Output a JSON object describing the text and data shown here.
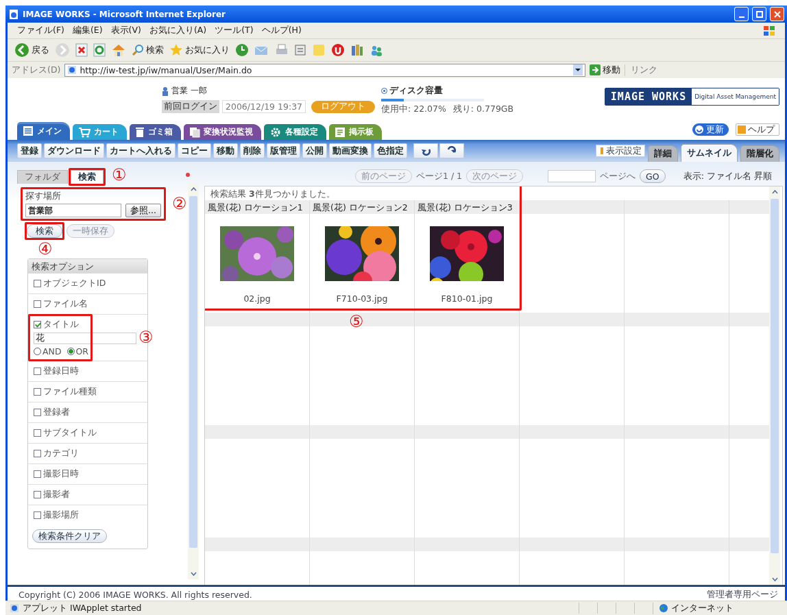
{
  "window": {
    "title": "IMAGE WORKS - Microsoft Internet Explorer"
  },
  "menu_bar": [
    "ファイル(F)",
    "編集(E)",
    "表示(V)",
    "お気に入り(A)",
    "ツール(T)",
    "ヘルプ(H)"
  ],
  "browser_toolbar": {
    "back": "戻る",
    "search": "検索",
    "favorites": "お気に入り"
  },
  "address_bar": {
    "label": "アドレス(D)",
    "url": "http://iw-test.jp/iw/manual/User/Main.do",
    "go": "移動",
    "links": "リンク"
  },
  "header": {
    "user": "営業 一郎",
    "last_login_label": "前回ログイン",
    "last_login": "2006/12/19 19:37",
    "logout": "ログアウト",
    "disk": {
      "label": "ディスク容量",
      "level": 0.22,
      "used": "使用中: 22.07%",
      "remaining": "残り: 0.779GB"
    },
    "logo": "IMAGE WORKS",
    "logo_sub": "Digital Asset Management",
    "refresh": "更新",
    "help": "ヘルプ"
  },
  "main_tabs": [
    {
      "label": "メイン",
      "color": "#2f6cc0",
      "selected": true
    },
    {
      "label": "カート",
      "color": "#2aa6d4",
      "selected": false
    },
    {
      "label": "ゴミ箱",
      "color": "#4b5ba6",
      "selected": false
    },
    {
      "label": "変換状況監視",
      "color": "#7a4c9c",
      "selected": false
    },
    {
      "label": "各種設定",
      "color": "#1b8a7e",
      "selected": false
    },
    {
      "label": "掲示板",
      "color": "#6e9c3a",
      "selected": false
    }
  ],
  "actions": [
    "登録",
    "ダウンロード",
    "カートへ入れる",
    "コピー",
    "移動",
    "削除",
    "版管理",
    "公開",
    "動画変換",
    "色指定"
  ],
  "display_settings": "表示設定",
  "view_tabs": [
    {
      "label": "詳細",
      "selected": false
    },
    {
      "label": "サムネイル",
      "selected": true
    },
    {
      "label": "階層化",
      "selected": false
    }
  ],
  "side_tabs": [
    {
      "label": "フォルダ",
      "selected": false
    },
    {
      "label": "検索",
      "selected": true
    }
  ],
  "search": {
    "location_label": "探す場所",
    "location": "営業部",
    "browse": "参照...",
    "search_button": "検索",
    "save_button": {
      "label": "一時保存",
      "disabled": true
    },
    "options_title": "検索オプション",
    "options": [
      {
        "kind": "checkbox",
        "label": "オブジェクトID",
        "checked": false
      },
      {
        "kind": "checkbox",
        "label": "ファイル名",
        "checked": false
      },
      {
        "kind": "text",
        "label": "タイトル",
        "checked": true,
        "value": "花",
        "operators": [
          {
            "label": "AND",
            "selected": false
          },
          {
            "label": "OR",
            "selected": true
          }
        ]
      },
      {
        "kind": "checkbox",
        "label": "登録日時",
        "checked": false
      },
      {
        "kind": "checkbox",
        "label": "ファイル種類",
        "checked": false
      },
      {
        "kind": "checkbox",
        "label": "登録者",
        "checked": false
      },
      {
        "kind": "checkbox",
        "label": "サブタイトル",
        "checked": false
      },
      {
        "kind": "checkbox",
        "label": "カテゴリ",
        "checked": false
      },
      {
        "kind": "checkbox",
        "label": "撮影日時",
        "checked": false
      },
      {
        "kind": "checkbox",
        "label": "撮影者",
        "checked": false
      },
      {
        "kind": "checkbox",
        "label": "撮影場所",
        "checked": false
      }
    ],
    "clear": "検索条件クリア"
  },
  "pagination": {
    "prev": {
      "label": "前のページ",
      "disabled": true
    },
    "page": "ページ1 / 1",
    "next": {
      "label": "次のページ",
      "disabled": true
    },
    "goto_label": "ページへ",
    "go": "GO"
  },
  "sort": "表示: ファイル名 昇順",
  "results": {
    "summary": "検索結果 **3**件見つかりました。",
    "items": [
      {
        "title": "風景(花) ロケーション1",
        "file": "02.jpg"
      },
      {
        "title": "風景(花) ロケーション2",
        "file": "F710-03.jpg"
      },
      {
        "title": "風景(花) ロケーション3",
        "file": "F810-01.jpg"
      }
    ]
  },
  "annotations": [
    "①",
    "②",
    "③",
    "④",
    "⑤"
  ],
  "footer": {
    "copyright": "Copyright (C) 2006 IMAGE WORKS. All rights reserved.",
    "admin_link": "管理者専用ページ"
  },
  "status_bar": {
    "text": "アプレット IWApplet started",
    "zone": "インターネット"
  }
}
